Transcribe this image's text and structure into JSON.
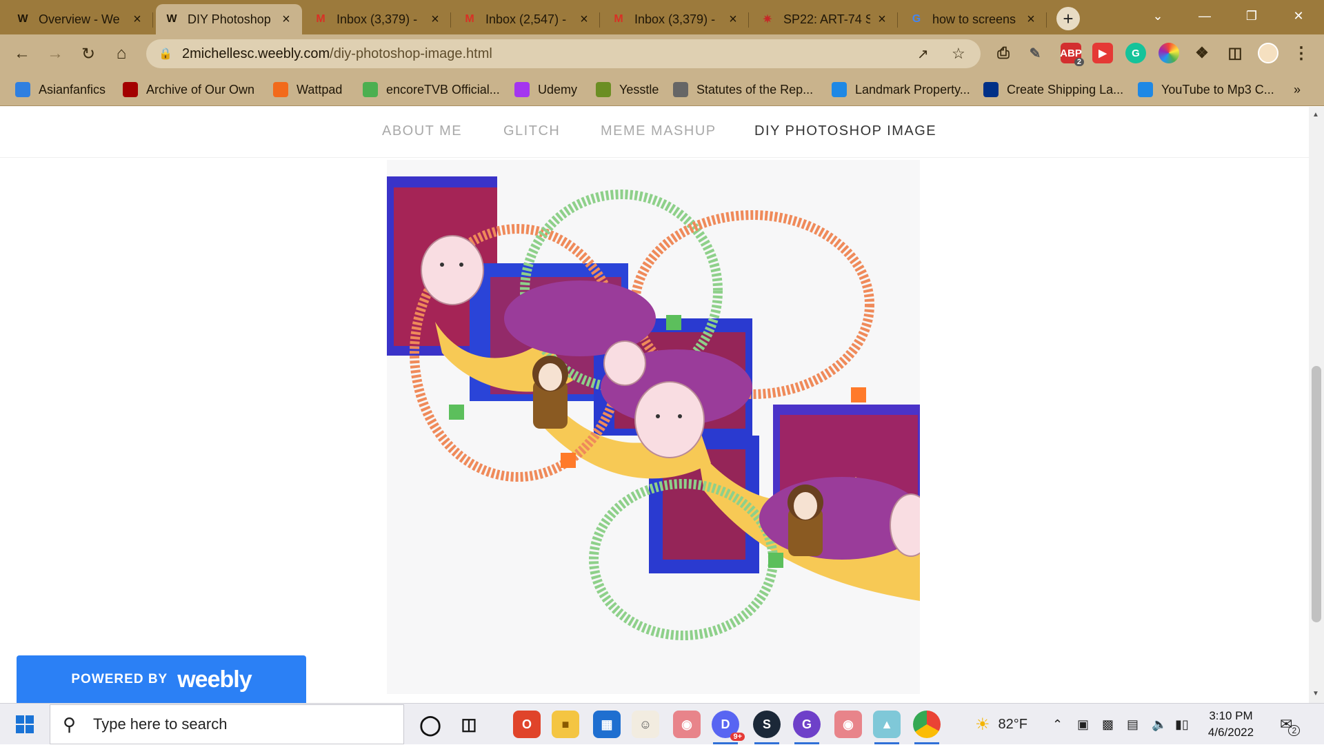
{
  "browser": {
    "tabs": [
      {
        "icon": "weebly-icon",
        "title": "Overview - We",
        "active": false
      },
      {
        "icon": "weebly-icon",
        "title": "DIY Photoshop",
        "active": true
      },
      {
        "icon": "gmail-icon",
        "title": "Inbox (3,379) -",
        "active": false
      },
      {
        "icon": "gmail-icon",
        "title": "Inbox (2,547) -",
        "active": false
      },
      {
        "icon": "gmail-icon",
        "title": "Inbox (3,379) -",
        "active": false
      },
      {
        "icon": "course-icon",
        "title": "SP22: ART-74 S",
        "active": false
      },
      {
        "icon": "google-icon",
        "title": "how to screens",
        "active": false
      }
    ],
    "new_tab_label": "+",
    "url": {
      "host": "2michellesc.weebly.com",
      "path": "/diy-photoshop-image.html"
    },
    "bookmarks": [
      {
        "label": "Asianfanfics",
        "icon": "asianfanfics-icon",
        "color": "#2f7fe0"
      },
      {
        "label": "Archive of Our Own",
        "icon": "ao3-icon",
        "color": "#a30000"
      },
      {
        "label": "Wattpad",
        "icon": "wattpad-icon",
        "color": "#f26a1b"
      },
      {
        "label": "encoreTVB Official...",
        "icon": "encoretvb-icon",
        "color": "#4caf50"
      },
      {
        "label": "Udemy",
        "icon": "udemy-icon",
        "color": "#a435f0"
      },
      {
        "label": "Yesstle",
        "icon": "yesstle-icon",
        "color": "#6b8e23"
      },
      {
        "label": "Statutes of the Rep...",
        "icon": "globe-icon",
        "color": "#666666"
      },
      {
        "label": "Landmark Property...",
        "icon": "landmark-icon",
        "color": "#1e88e5"
      },
      {
        "label": "Create Shipping La...",
        "icon": "paypal-icon",
        "color": "#003087"
      },
      {
        "label": "YouTube to Mp3 C...",
        "icon": "download-icon",
        "color": "#1e88e5"
      }
    ],
    "bookmarks_more": "»"
  },
  "site": {
    "nav": [
      {
        "label": "ABOUT ME",
        "current": false
      },
      {
        "label": "GLITCH",
        "current": false
      },
      {
        "label": "MEME MASHUP",
        "current": false
      },
      {
        "label": "DIY PHOTOSHOP IMAGE",
        "current": true
      }
    ],
    "powered_by": {
      "prefix": "POWERED BY",
      "brand": "weebly"
    }
  },
  "taskbar": {
    "search_placeholder": "Type here to search",
    "weather": "82°F",
    "time": "3:10 PM",
    "date": "4/6/2022",
    "notification_count": "2",
    "discord_badge": "9+",
    "extension_badge": "2"
  },
  "colors": {
    "tabstrip": "#9c7a3c",
    "toolbar": "#c9b38c",
    "weebly_blue": "#2b80f5"
  }
}
